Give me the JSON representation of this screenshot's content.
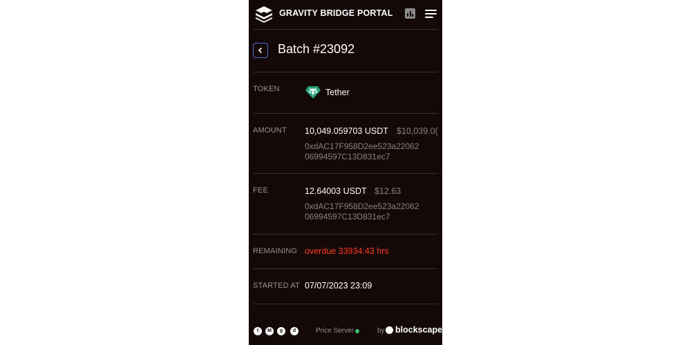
{
  "header": {
    "brand": "GRAVITY BRIDGE PORTAL",
    "logo_icon": "gravity-bridge-logo",
    "chart_icon": "bar-chart-icon",
    "menu_icon": "hamburger-menu-icon"
  },
  "page": {
    "title": "Batch #23092",
    "back_icon": "chevron-left-icon"
  },
  "details": {
    "token": {
      "label": "TOKEN",
      "name": "Tether",
      "icon": "tether-icon"
    },
    "amount": {
      "label": "AMOUNT",
      "value": "10,049.059703 USDT",
      "usd": "$10,039.0(",
      "address_line1": "0xdAC17F958D2ee523a22062",
      "address_line2": "06994597C13D831ec7"
    },
    "fee": {
      "label": "FEE",
      "value": "12.64003 USDT",
      "usd": "$12.63",
      "address_line1": "0xdAC17F958D2ee523a22062",
      "address_line2": "06994597C13D831ec7"
    },
    "remaining": {
      "label": "REMAINING",
      "value": "overdue 33934:43 hrs"
    },
    "started": {
      "label": "STARTED AT",
      "value": "07/07/2023 23:09"
    }
  },
  "footer": {
    "social_icons": [
      "twitter-icon",
      "medium-icon",
      "github-icon",
      "discord-icon"
    ],
    "price_server": "Price Server",
    "price_server_status_color": "#3ec26b",
    "by": "by",
    "company": "blockscape",
    "company_icon": "blockscape-icon"
  },
  "colors": {
    "background": "#140907",
    "accent": "#4a6fd6",
    "overdue": "#ff3a1e"
  }
}
